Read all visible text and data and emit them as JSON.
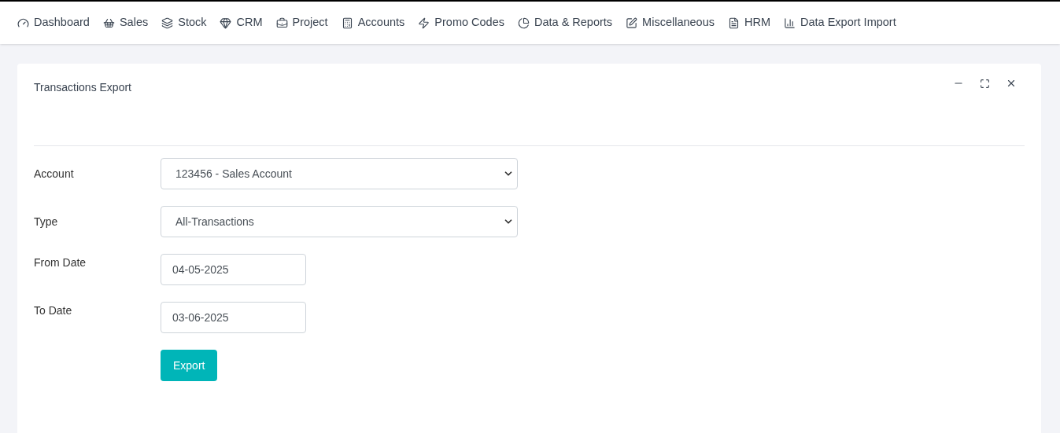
{
  "nav": [
    {
      "label": "Dashboard"
    },
    {
      "label": "Sales"
    },
    {
      "label": "Stock"
    },
    {
      "label": "CRM"
    },
    {
      "label": "Project"
    },
    {
      "label": "Accounts"
    },
    {
      "label": "Promo Codes"
    },
    {
      "label": "Data & Reports"
    },
    {
      "label": "Miscellaneous"
    },
    {
      "label": "HRM"
    },
    {
      "label": "Data Export Import"
    }
  ],
  "panel": {
    "title": "Transactions Export",
    "fields": [
      {
        "label": "Account",
        "kind": "select",
        "value": "123456 - Sales Account"
      },
      {
        "label": "Type",
        "kind": "select",
        "value": "All-Transactions"
      },
      {
        "label": "From Date",
        "kind": "date",
        "value": "04-05-2025"
      },
      {
        "label": "To Date",
        "kind": "date",
        "value": "03-06-2025"
      }
    ],
    "button": "Export"
  }
}
